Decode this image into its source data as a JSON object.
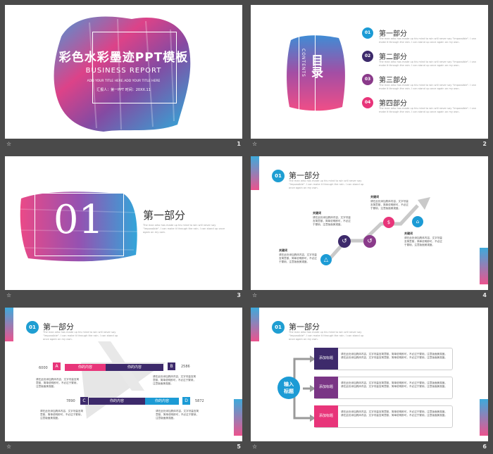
{
  "colors": {
    "pink": "#e8357a",
    "blue": "#1c9bd5",
    "purple": "#5b2f87",
    "dark": "#3d2a6b",
    "magenta": "#c43f8a"
  },
  "slide1": {
    "title": "彩色水彩墨迹PPT模板",
    "subtitle": "BUSINESS REPORT",
    "small": "ADD YOUR TITLE HERE.ADD YOUR TITLE HERE",
    "reporter": "汇报人：第一PPT    时间：20XX.11",
    "num": "1"
  },
  "slide2": {
    "heading": "目录",
    "heading_en": "CONTENTS",
    "items": [
      {
        "n": "01",
        "label": "第一部分",
        "color": "#1c9bd5"
      },
      {
        "n": "02",
        "label": "第二部分",
        "color": "#3d2a6b"
      },
      {
        "n": "03",
        "label": "第三部分",
        "color": "#8a3a8a"
      },
      {
        "n": "04",
        "label": "第四部分",
        "color": "#e8357a"
      }
    ],
    "desc": "The man who has made up his mind to win will never say \"Impossible\". I can make it through the rain. I can stand up once again on my own.",
    "num": "2"
  },
  "slide3": {
    "big_num": "01",
    "title": "第一部分",
    "desc": "The man who has made up his mind to win will never say \"Impossible\". I can make it through the rain. I can stand up once again on my own.",
    "num": "3"
  },
  "slide4": {
    "hd_num": "01",
    "hd_title": "第一部分",
    "hd_desc": "The man who has made up his mind to win will never say \"Impossible\". I can make it through the rain. I can stand up once again on my own.",
    "key": "关键词",
    "text": "请在此处添加具体内容，文字尽量言简意赅，简单说明即可，不必过于繁琐，注意版面美观度。",
    "num": "4"
  },
  "slide5": {
    "hd_num": "01",
    "hd_title": "第一部分",
    "hd_desc": "The man who has made up his mind to win will never say \"Impossible\". I can make it through the rain. I can stand up once again on my own.",
    "values": {
      "a": "6000",
      "b": "2586",
      "c": "7890",
      "d": "5872"
    },
    "letters": {
      "a": "A",
      "b": "B",
      "c": "C",
      "d": "D"
    },
    "band": "你的内容",
    "text": "请在此处添加具体内容，文字尽量言简意赅，简单说明即可，不必过于繁琐，注意版面美观度。",
    "num": "5"
  },
  "slide6": {
    "hd_num": "01",
    "hd_title": "第一部分",
    "hd_desc": "The man who has made up his mind to win will never say \"Impossible\". I can make it through the rain. I can stand up once again on my own.",
    "center": "输入\n标题",
    "tag": "添加标题",
    "text": "请在此处添加具体内容，文字尽量言简意赅，简单说明即可，不必过于繁琐，注意版面美观度。请在此处添加具体内容，文字尽量言简意赅，简单说明即可，不必过于繁琐，注意版面美观度。",
    "num": "6"
  },
  "star": "☆"
}
